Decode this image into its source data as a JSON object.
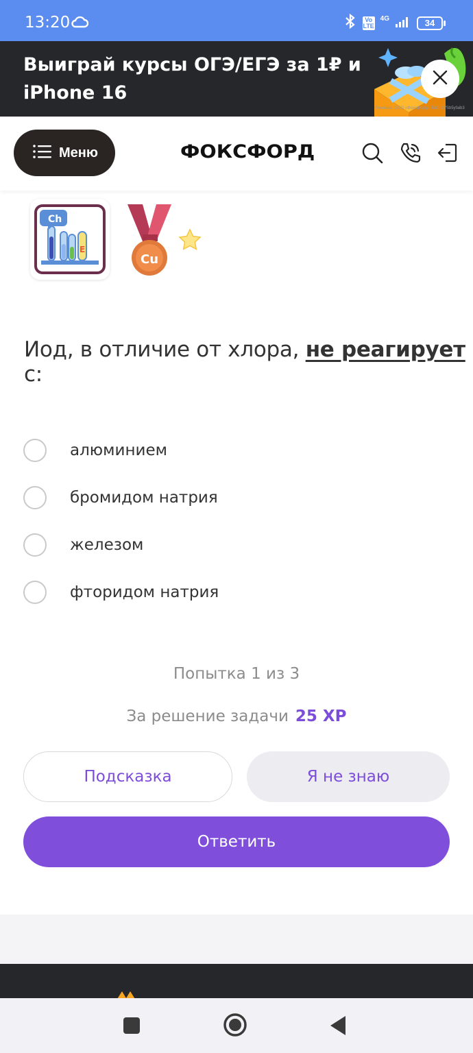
{
  "status_bar": {
    "time": "13:20",
    "network": "4G",
    "volte": "Vo LTE",
    "battery": "34",
    "icons": [
      "cloud-icon",
      "bluetooth-icon",
      "signal-icon",
      "battery-icon"
    ]
  },
  "promo": {
    "title": "Выиграй курсы ОГЭ/ЕГЭ за 1₽ и iPhone 16",
    "legal": "Реклама. ООО «Фоксфорд». Erid: 2VSb5yfaib3",
    "close_icon": "close-icon"
  },
  "header": {
    "menu_label": "Меню",
    "logo": "ФОКСФОРД",
    "icons": [
      "search-icon",
      "phone-icon",
      "login-icon"
    ]
  },
  "badges": {
    "chem_symbol": "Ch",
    "chem_tube_label": "E",
    "medal_symbol": "Cu"
  },
  "question": {
    "text_before": "Иод, в отличие от хлора, ",
    "text_emphasis": "не реагирует",
    "text_after": " с:"
  },
  "options": [
    {
      "label": "алюминием",
      "selected": false
    },
    {
      "label": "бромидом натрия",
      "selected": false
    },
    {
      "label": "железом",
      "selected": false
    },
    {
      "label": "фторидом натрия",
      "selected": false
    }
  ],
  "attempt": "Попытка 1 из 3",
  "reward": {
    "label": "За решение задачи",
    "xp": "25 XP"
  },
  "buttons": {
    "hint": "Подсказка",
    "dont_know": "Я не знаю",
    "answer": "Ответить"
  },
  "colors": {
    "accent": "#7f4fdc",
    "status_bar": "#5b8cf0",
    "dark": "#26272b"
  }
}
